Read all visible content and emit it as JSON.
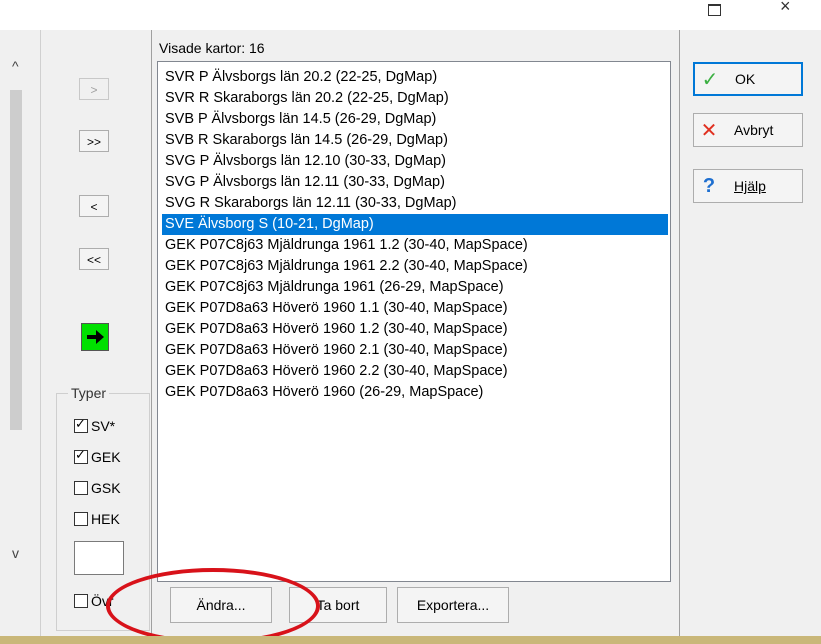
{
  "window": {
    "maximize_icon": "maximize-icon",
    "close_icon": "close-icon",
    "close_glyph": "×"
  },
  "scroll": {
    "up_glyph": "^",
    "down_glyph": "v"
  },
  "transfer_buttons": {
    "add": ">",
    "add_all": ">>",
    "remove": "<",
    "remove_all": "<<"
  },
  "typer": {
    "title": "Typer",
    "items": [
      {
        "label": "SV*",
        "checked": true
      },
      {
        "label": "GEK",
        "checked": true
      },
      {
        "label": "GSK",
        "checked": false
      },
      {
        "label": "HEK",
        "checked": false
      }
    ],
    "other_label": "Övr"
  },
  "list": {
    "label": "Visade kartor: 16",
    "items": [
      "SVR P Älvsborgs län 20.2 (22-25, DgMap)",
      "SVR R Skaraborgs län 20.2 (22-25, DgMap)",
      "SVB P Älvsborgs län 14.5 (26-29, DgMap)",
      "SVB R Skaraborgs län 14.5 (26-29, DgMap)",
      "SVG P Älvsborgs län 12.10 (30-33, DgMap)",
      "SVG P Älvsborgs län 12.11 (30-33, DgMap)",
      "SVG R Skaraborgs län 12.11 (30-33, DgMap)",
      "SVE Älvsborg S (10-21, DgMap)",
      "GEK P07C8j63 Mjäldrunga 1961 1.2 (30-40, MapSpace)",
      "GEK P07C8j63 Mjäldrunga 1961 2.2 (30-40, MapSpace)",
      "GEK P07C8j63 Mjäldrunga 1961 (26-29, MapSpace)",
      "GEK P07D8a63 Höverö 1960 1.1 (30-40, MapSpace)",
      "GEK P07D8a63 Höverö 1960 1.2 (30-40, MapSpace)",
      "GEK P07D8a63 Höverö 1960 2.1 (30-40, MapSpace)",
      "GEK P07D8a63 Höverö 1960 2.2 (30-40, MapSpace)",
      "GEK P07D8a63 Höverö 1960 (26-29, MapSpace)"
    ],
    "selected_index": 7
  },
  "bottom_buttons": {
    "change": "Ändra...",
    "remove": "Ta bort",
    "export": "Exportera..."
  },
  "right_buttons": {
    "ok": {
      "label": "OK",
      "icon": "check-icon",
      "glyph": "✓",
      "color": "#3cb043"
    },
    "cancel": {
      "label": "Avbryt",
      "icon": "x-icon",
      "glyph": "✕",
      "color": "#e03020"
    },
    "help": {
      "label": "Hjälp",
      "icon": "question-icon",
      "glyph": "?",
      "color": "#1e6fd0"
    }
  },
  "colors": {
    "selection": "#0078d7",
    "annotation_circle": "#d8121a",
    "green_button": "#00e000"
  }
}
